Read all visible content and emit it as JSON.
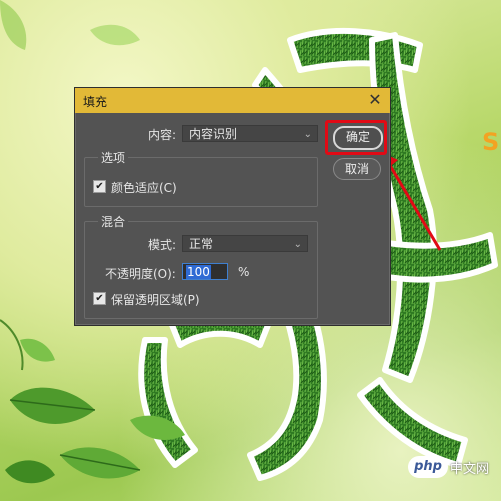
{
  "dialog": {
    "title": "填充",
    "close_glyph": "✕",
    "content_label": "内容:",
    "content_value": "内容识别",
    "ok_label": "确定",
    "cancel_label": "取消",
    "options": {
      "group_title": "选项",
      "color_adapt_label": "颜色适应(C)",
      "color_adapt_checked": true
    },
    "blend": {
      "group_title": "混合",
      "mode_label": "模式:",
      "mode_value": "正常",
      "opacity_label": "不透明度(O):",
      "opacity_value": "100",
      "opacity_unit": "%",
      "preserve_label": "保留透明区域(P)",
      "preserve_checked": true
    }
  },
  "checkmark_glyph": "✔",
  "chevron_glyph": "⌄",
  "watermark": {
    "logo": "php",
    "text": "中文网"
  },
  "colors": {
    "titlebar": "#e2b937",
    "dialog_bg": "#535353",
    "highlight": "#e10a15",
    "grass": "#3f8a2a"
  }
}
